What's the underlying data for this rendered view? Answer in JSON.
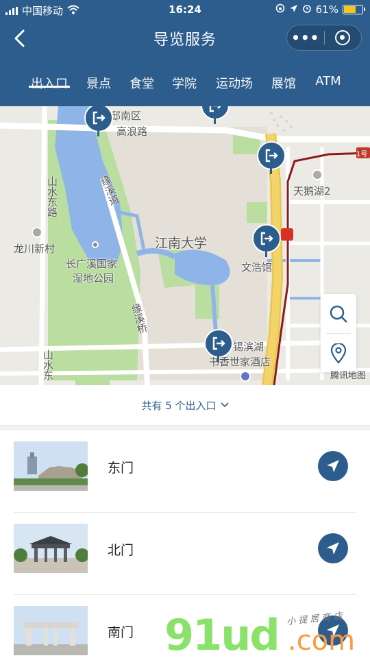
{
  "status_bar": {
    "carrier": "中国移动",
    "time": "16:24",
    "battery": "61%"
  },
  "nav": {
    "title": "导览服务",
    "more_label": "•••"
  },
  "tabs": [
    {
      "label": "出入口",
      "active": true
    },
    {
      "label": "景点",
      "active": false
    },
    {
      "label": "食堂",
      "active": false
    },
    {
      "label": "学院",
      "active": false
    },
    {
      "label": "运动场",
      "active": false
    },
    {
      "label": "展馆",
      "active": false
    },
    {
      "label": "ATM",
      "active": false
    }
  ],
  "map": {
    "labels": {
      "mingdi_nanqu": "铭邸南区",
      "gaolang_road": "高浪路",
      "tiane_lake": "天鹅湖2",
      "shan_shui_dong_road": "山水东路",
      "yuanxi_road": "缘溪道",
      "longchuan_village": "龙川新村",
      "changguangxi_park_1": "长广溪国家",
      "changguangxi_park_2": "湿地公园",
      "jiangnan_university": "江南大学",
      "wenhao_hall": "文浩馆",
      "yuanxi_bridge": "缘溪桥",
      "xibin_lake": "锡滨湖",
      "shuxiang_hotel": "书香世家酒店",
      "shanshuidong": "山水东",
      "route_badge": "1号"
    },
    "brand": "腾讯地图"
  },
  "count_bar": {
    "text": "共有 5 个出入口"
  },
  "entrances": [
    {
      "name": "东门"
    },
    {
      "name": "北门"
    },
    {
      "name": "南门"
    }
  ],
  "watermark": {
    "main": "91ud",
    "suffix": ".com",
    "hand": "小 提 居 商 店"
  },
  "colors": {
    "primary": "#2d5d8c",
    "map_water": "#8fb5e8",
    "map_green": "#b9dea0",
    "map_road_yellow": "#f3d46a",
    "metro_red": "#c0392b"
  }
}
